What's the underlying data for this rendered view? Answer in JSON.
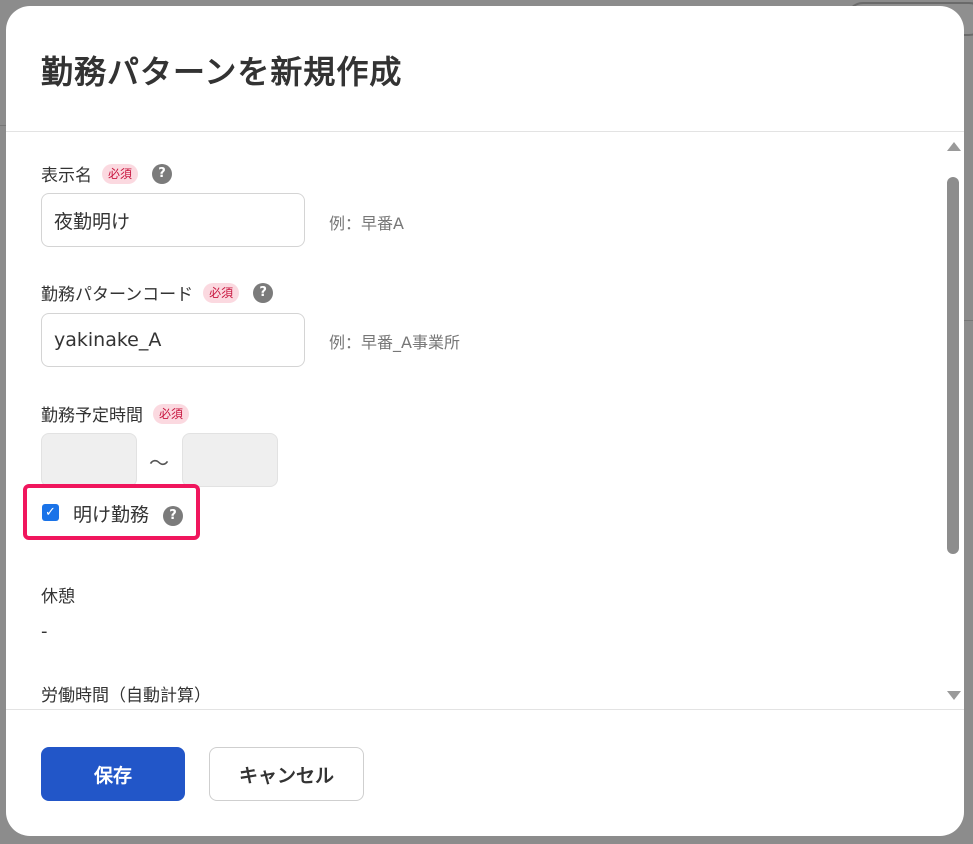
{
  "dialog": {
    "title": "勤務パターンを新規作成"
  },
  "fields": {
    "display_name": {
      "label": "表示名",
      "required_badge": "必須",
      "value": "夜勤明け",
      "hint": "例：早番A"
    },
    "pattern_code": {
      "label": "勤務パターンコード",
      "required_badge": "必須",
      "value": "yakinake_A",
      "hint": "例：早番_A事業所"
    },
    "scheduled_time": {
      "label": "勤務予定時間",
      "required_badge": "必須",
      "start": "",
      "end": "",
      "separator": "〜"
    },
    "ake_kinmu": {
      "label": "明け勤務",
      "checked": true
    },
    "break": {
      "label": "休憩",
      "value": "-"
    },
    "work_hours": {
      "label": "労働時間（自動計算）"
    }
  },
  "help_icon_glyph": "?",
  "checkmark_glyph": "✓",
  "footer": {
    "save_label": "保存",
    "cancel_label": "キャンセル"
  },
  "colors": {
    "primary": "#2256c8",
    "required_bg": "#fbd9e0",
    "required_text": "#c8163f",
    "highlight": "#f0165d",
    "checkbox": "#1a73e8"
  }
}
